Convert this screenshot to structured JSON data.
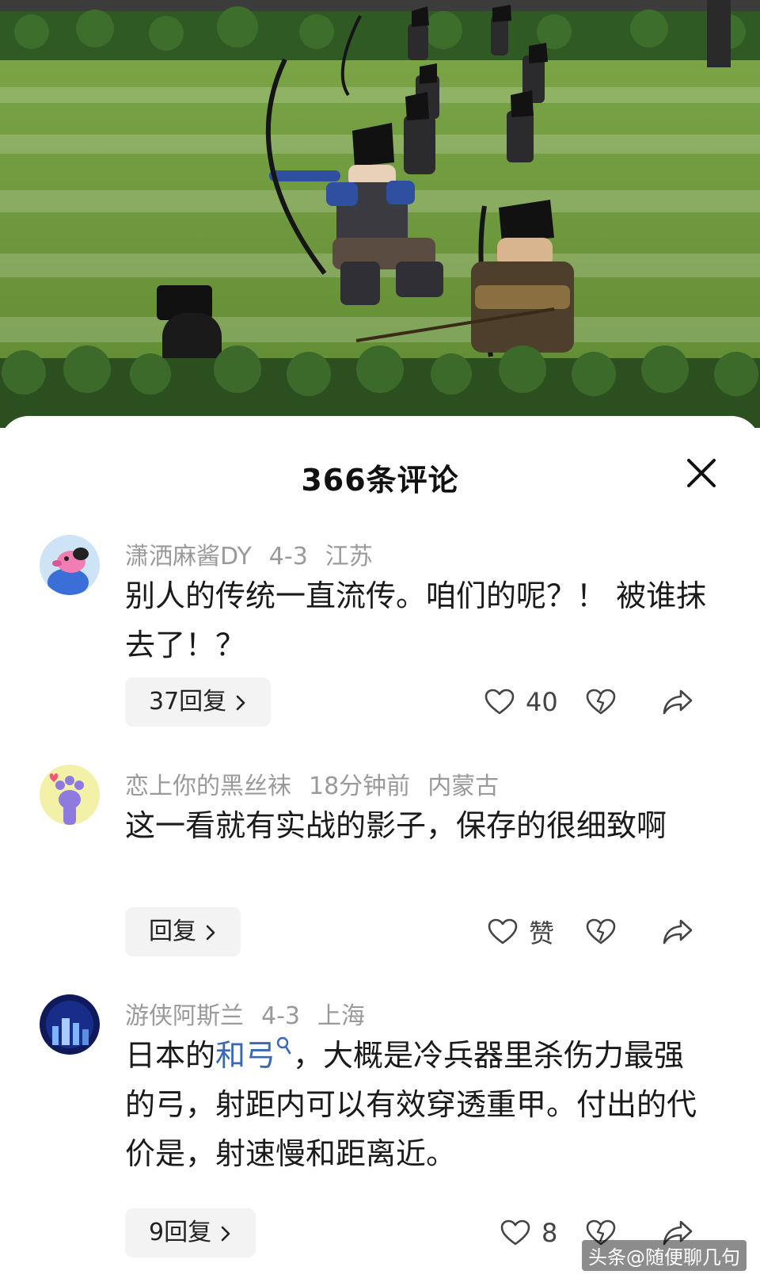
{
  "sheet": {
    "title": "366条评论"
  },
  "comments": [
    {
      "username": "潇洒麻酱DY",
      "date": "4-3",
      "location": "江苏",
      "text": "别人的传统一直流传。咱们的呢？！ 被谁抹去了！？",
      "reply_label": "37回复",
      "like_label": "40",
      "avatar": "cartoon-dog-avatar"
    },
    {
      "username": "恋上你的黑丝袜",
      "date": "18分钟前",
      "location": "内蒙古",
      "text": "这一看就有实战的影子，保存的很细致啊",
      "reply_label": "回复",
      "like_label": "赞",
      "avatar": "paw-avatar"
    },
    {
      "username": "游侠阿斯兰",
      "date": "4-3",
      "location": "上海",
      "text_before_link": "日本的",
      "link_text": "和弓",
      "text_after_link": "，大概是冷兵器里杀伤力最强的弓，射距内可以有效穿透重甲。付出的代价是，射速慢和距离近。",
      "reply_label": "9回复",
      "like_label": "8",
      "avatar": "night-city-avatar"
    }
  ],
  "watermark": "头条@随便聊几句",
  "colors": {
    "link": "#3a67b8",
    "meta": "#9a9a9a",
    "reply_bg": "#f3f3f3",
    "grass": "#6f9b3c"
  }
}
